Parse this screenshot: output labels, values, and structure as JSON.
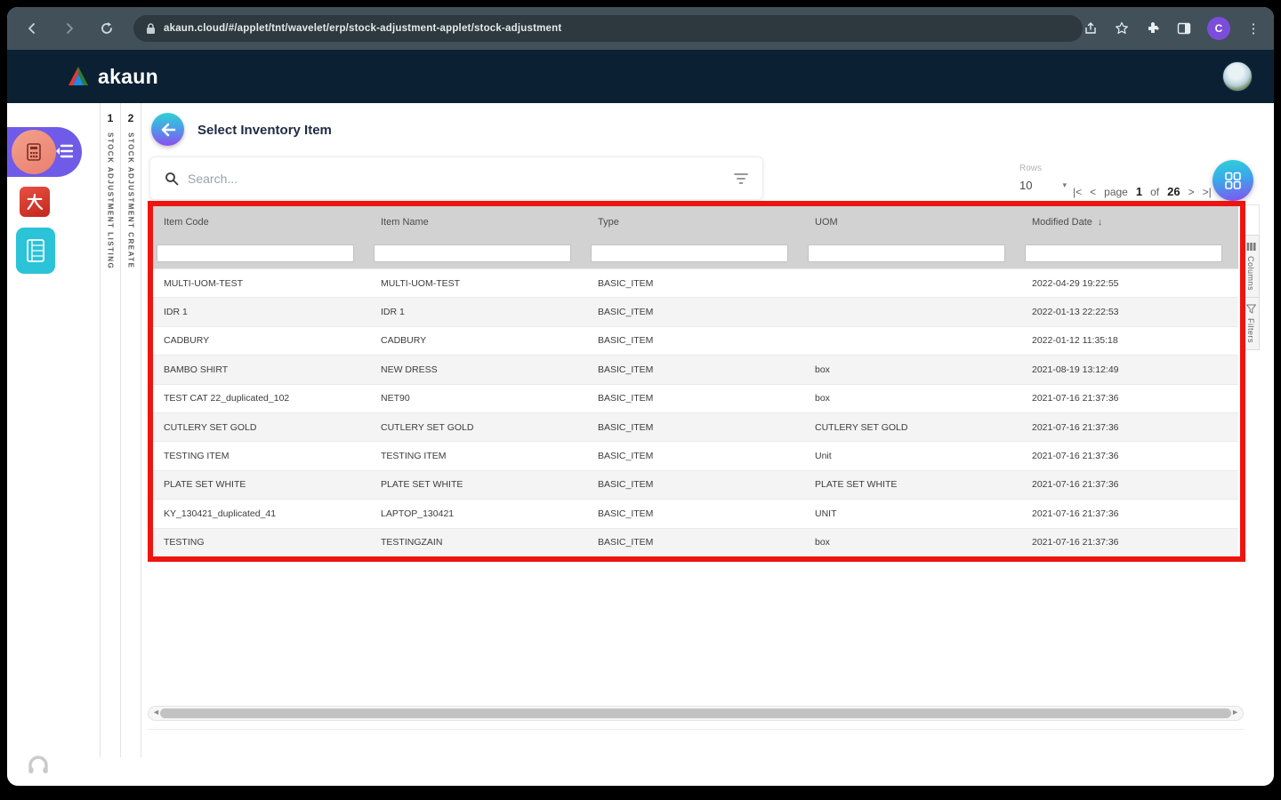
{
  "browser": {
    "url": "akaun.cloud/#/applet/tnt/wavelet/erp/stock-adjustment-applet/stock-adjustment",
    "profile_initial": "C"
  },
  "header": {
    "brand": "akaun"
  },
  "tabs": [
    {
      "number": "1",
      "label": "STOCK ADJUSTMENT LISTING"
    },
    {
      "number": "2",
      "label": "STOCK ADJUSTMENT CREATE"
    }
  ],
  "main": {
    "title": "Select Inventory Item",
    "search": {
      "placeholder": "Search..."
    },
    "pagination": {
      "rows_label": "Rows",
      "rows_value": "10",
      "caret": "▾",
      "first": "|<",
      "prev": "<",
      "page_label": "page",
      "page_current": "1",
      "of_label": "of",
      "page_total": "26",
      "next": ">",
      "last": ">|"
    },
    "table": {
      "columns": [
        {
          "key": "item_code",
          "label": "Item Code"
        },
        {
          "key": "item_name",
          "label": "Item Name"
        },
        {
          "key": "type",
          "label": "Type"
        },
        {
          "key": "uom",
          "label": "UOM"
        },
        {
          "key": "modified_date",
          "label": "Modified Date",
          "sort": "↓"
        }
      ],
      "rows": [
        {
          "item_code": "MULTI-UOM-TEST",
          "item_name": "MULTI-UOM-TEST",
          "type": "BASIC_ITEM",
          "uom": "",
          "modified_date": "2022-04-29 19:22:55"
        },
        {
          "item_code": "IDR 1",
          "item_name": "IDR 1",
          "type": "BASIC_ITEM",
          "uom": "",
          "modified_date": "2022-01-13 22:22:53"
        },
        {
          "item_code": "CADBURY",
          "item_name": "CADBURY",
          "type": "BASIC_ITEM",
          "uom": "",
          "modified_date": "2022-01-12 11:35:18"
        },
        {
          "item_code": "BAMBO SHIRT",
          "item_name": "NEW DRESS",
          "type": "BASIC_ITEM",
          "uom": "box",
          "modified_date": "2021-08-19 13:12:49"
        },
        {
          "item_code": "TEST CAT 22_duplicated_102",
          "item_name": "NET90",
          "type": "BASIC_ITEM",
          "uom": "box",
          "modified_date": "2021-07-16 21:37:36"
        },
        {
          "item_code": "CUTLERY SET GOLD",
          "item_name": "CUTLERY SET GOLD",
          "type": "BASIC_ITEM",
          "uom": "CUTLERY SET GOLD",
          "modified_date": "2021-07-16 21:37:36"
        },
        {
          "item_code": "TESTING ITEM",
          "item_name": "TESTING ITEM",
          "type": "BASIC_ITEM",
          "uom": "Unit",
          "modified_date": "2021-07-16 21:37:36"
        },
        {
          "item_code": "PLATE SET WHITE",
          "item_name": "PLATE SET WHITE",
          "type": "BASIC_ITEM",
          "uom": "PLATE SET WHITE",
          "modified_date": "2021-07-16 21:37:36"
        },
        {
          "item_code": "KY_130421_duplicated_41",
          "item_name": "LAPTOP_130421",
          "type": "BASIC_ITEM",
          "uom": "UNIT",
          "modified_date": "2021-07-16 21:37:36"
        },
        {
          "item_code": "TESTING",
          "item_name": "TESTINGZAIN",
          "type": "BASIC_ITEM",
          "uom": "box",
          "modified_date": "2021-07-16 21:37:36"
        }
      ]
    },
    "side_panel": {
      "columns_label": "Columns",
      "filters_label": "Filters"
    }
  },
  "icons": {
    "kebab": "⋮",
    "scroll_left": "◄",
    "scroll_right": "►"
  },
  "colors": {
    "chrome": "#42505a",
    "app_header": "#0b2133",
    "accent_cyan": "#2ed3d6",
    "accent_purple": "#8a4df2",
    "annotation_red": "#ee1410",
    "table_header": "#d2d2d2",
    "row_alt": "#f4f4f4",
    "sidebar_purple": "#6f5be8",
    "sidebar_salmon": "#ef8b7a",
    "sidebar_red": "#d6352b",
    "sidebar_teal": "#2bc3d8"
  }
}
